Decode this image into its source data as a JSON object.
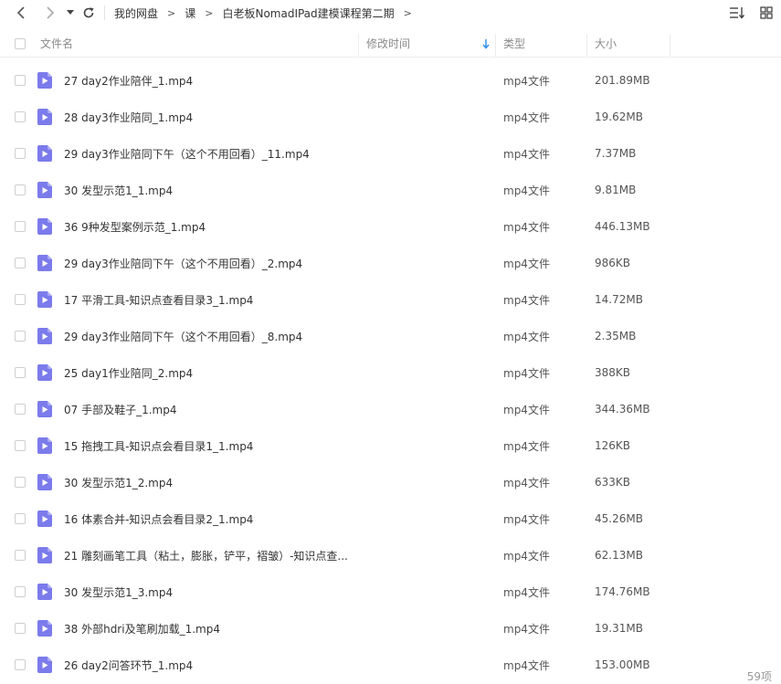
{
  "nav": {
    "breadcrumb": [
      "我的网盘",
      "课",
      "白老板NomadIPad建模课程第二期"
    ],
    "separator": ">"
  },
  "columns": {
    "name": "文件名",
    "modified": "修改时间",
    "type": "类型",
    "size": "大小"
  },
  "files": [
    {
      "name": "27  day2作业陪伴_1.mp4",
      "type": "mp4文件",
      "size": "201.89MB"
    },
    {
      "name": "28  day3作业陪同_1.mp4",
      "type": "mp4文件",
      "size": "19.62MB"
    },
    {
      "name": "29  day3作业陪同下午（这个不用回看）_11.mp4",
      "type": "mp4文件",
      "size": "7.37MB"
    },
    {
      "name": "30  发型示范1_1.mp4",
      "type": "mp4文件",
      "size": "9.81MB"
    },
    {
      "name": "36  9种发型案例示范_1.mp4",
      "type": "mp4文件",
      "size": "446.13MB"
    },
    {
      "name": "29  day3作业陪同下午（这个不用回看）_2.mp4",
      "type": "mp4文件",
      "size": "986KB"
    },
    {
      "name": "17  平滑工具-知识点查看目录3_1.mp4",
      "type": "mp4文件",
      "size": "14.72MB"
    },
    {
      "name": "29  day3作业陪同下午（这个不用回看）_8.mp4",
      "type": "mp4文件",
      "size": "2.35MB"
    },
    {
      "name": "25  day1作业陪同_2.mp4",
      "type": "mp4文件",
      "size": "388KB"
    },
    {
      "name": "07  手部及鞋子_1.mp4",
      "type": "mp4文件",
      "size": "344.36MB"
    },
    {
      "name": "15  拖拽工具-知识点会看目录1_1.mp4",
      "type": "mp4文件",
      "size": "126KB"
    },
    {
      "name": "30  发型示范1_2.mp4",
      "type": "mp4文件",
      "size": "633KB"
    },
    {
      "name": "16  体素合并-知识点会看目录2_1.mp4",
      "type": "mp4文件",
      "size": "45.26MB"
    },
    {
      "name": "21  雕刻画笔工具（粘土，膨胀，铲平，褶皱）-知识点查...",
      "type": "mp4文件",
      "size": "62.13MB"
    },
    {
      "name": "30  发型示范1_3.mp4",
      "type": "mp4文件",
      "size": "174.76MB"
    },
    {
      "name": "38  外部hdri及笔刷加载_1.mp4",
      "type": "mp4文件",
      "size": "19.31MB"
    },
    {
      "name": "26  day2问答环节_1.mp4",
      "type": "mp4文件",
      "size": "153.00MB"
    }
  ],
  "status": {
    "count": "59项"
  },
  "colors": {
    "icon": "#7b7bec",
    "sort_arrow": "#2a8cf0"
  }
}
